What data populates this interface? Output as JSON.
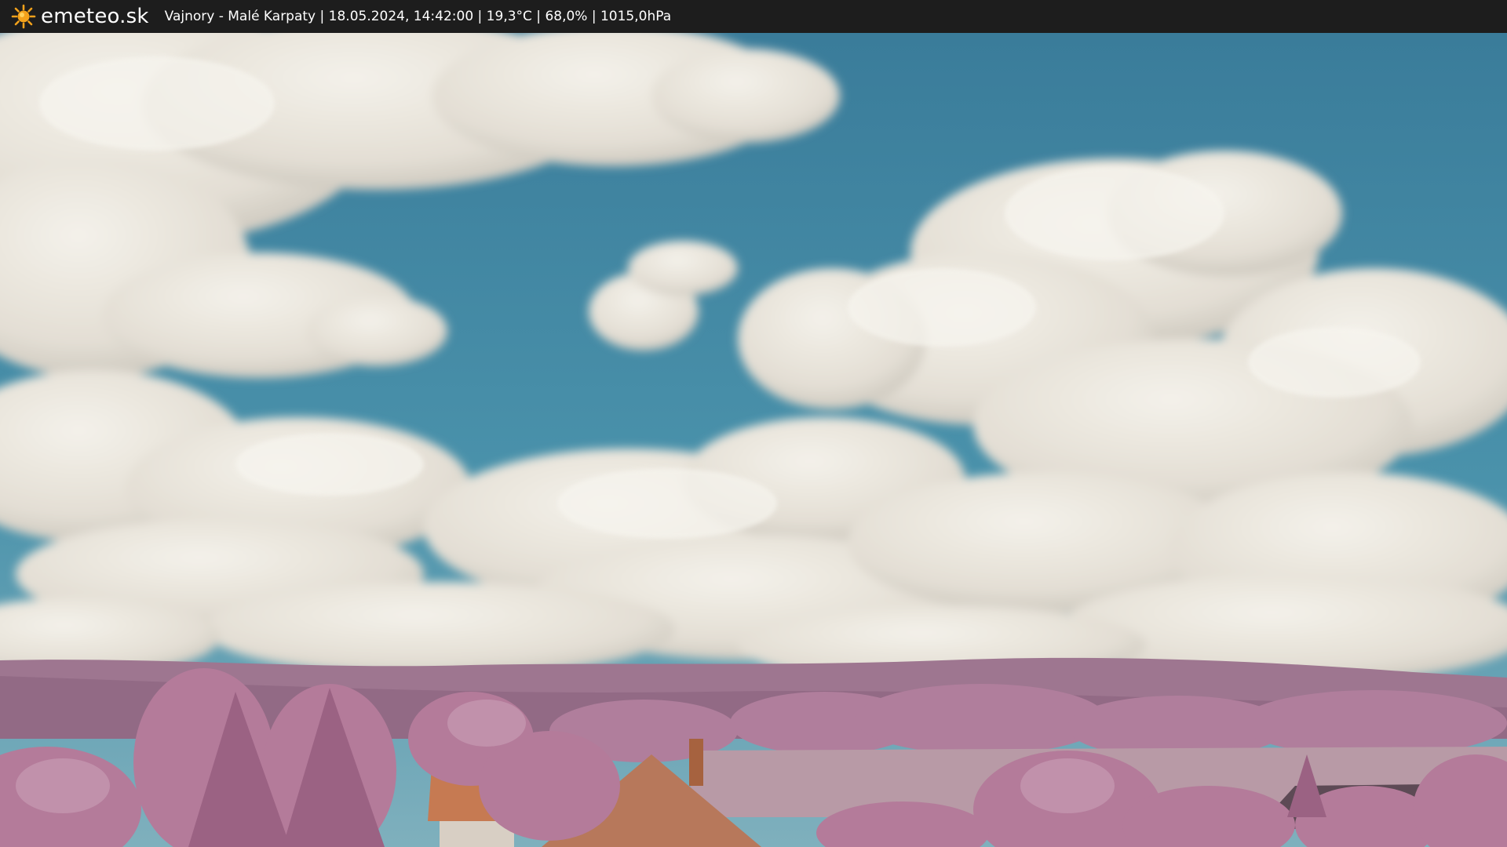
{
  "header": {
    "logo_icon": "sun-icon",
    "brand": "emeteo.sk",
    "info": "Vajnory - Malé Karpaty | 18.05.2024, 14:42:00 | 19,3°C | 68,0% | 1015,0hPa"
  },
  "colors": {
    "header_bg": "#1d1d1d",
    "sun": "#f4a21b",
    "sky": "#3f8aa6",
    "foliage": "#b87c9e"
  }
}
